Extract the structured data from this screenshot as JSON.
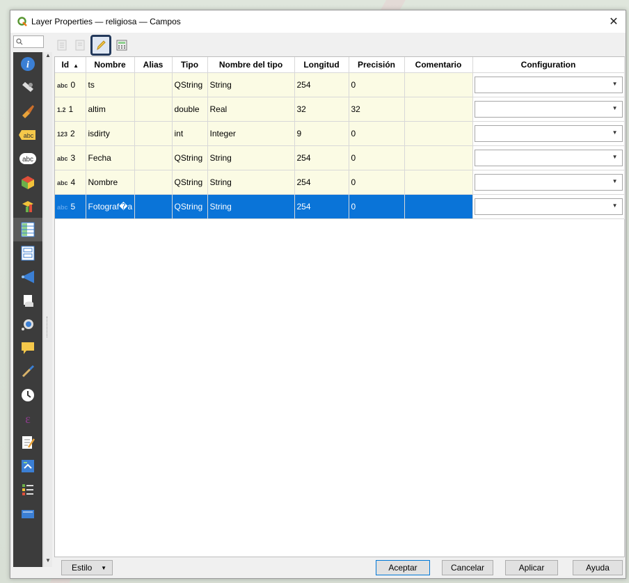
{
  "window": {
    "title": "Layer Properties — religiosa — Campos",
    "close_glyph": "✕"
  },
  "sidebar": {
    "search_glyph": "🔍",
    "items": [
      {
        "name": "information-icon"
      },
      {
        "name": "source-icon"
      },
      {
        "name": "symbology-icon"
      },
      {
        "name": "labels-icon"
      },
      {
        "name": "masks-icon"
      },
      {
        "name": "3d-view-icon"
      },
      {
        "name": "diagrams-icon"
      },
      {
        "name": "fields-icon"
      },
      {
        "name": "attributes-form-icon"
      },
      {
        "name": "joins-icon"
      },
      {
        "name": "auxiliary-storage-icon"
      },
      {
        "name": "actions-icon"
      },
      {
        "name": "display-icon"
      },
      {
        "name": "rendering-icon"
      },
      {
        "name": "temporal-icon"
      },
      {
        "name": "variables-icon"
      },
      {
        "name": "metadata-icon"
      },
      {
        "name": "dependencies-icon"
      },
      {
        "name": "legend-icon"
      },
      {
        "name": "server-icon"
      }
    ]
  },
  "toolbar": {
    "buttons": [
      "new-field-icon",
      "delete-field-icon",
      "toggle-editing-icon",
      "field-calculator-icon"
    ]
  },
  "table": {
    "headers": [
      "Id",
      "Nombre",
      "Alias",
      "Tipo",
      "Nombre del tipo",
      "Longitud",
      "Precisión",
      "Comentario",
      "Configuration"
    ],
    "rows": [
      {
        "typeicon": "abc",
        "id": "0",
        "name": "ts",
        "alias": "",
        "type": "QString",
        "typename": "String",
        "length": "254",
        "precision": "0",
        "comment": ""
      },
      {
        "typeicon": "1.2",
        "id": "1",
        "name": "altim",
        "alias": "",
        "type": "double",
        "typename": "Real",
        "length": "32",
        "precision": "32",
        "comment": ""
      },
      {
        "typeicon": "123",
        "id": "2",
        "name": "isdirty",
        "alias": "",
        "type": "int",
        "typename": "Integer",
        "length": "9",
        "precision": "0",
        "comment": ""
      },
      {
        "typeicon": "abc",
        "id": "3",
        "name": "Fecha",
        "alias": "",
        "type": "QString",
        "typename": "String",
        "length": "254",
        "precision": "0",
        "comment": ""
      },
      {
        "typeicon": "abc",
        "id": "4",
        "name": "Nombre",
        "alias": "",
        "type": "QString",
        "typename": "String",
        "length": "254",
        "precision": "0",
        "comment": ""
      },
      {
        "typeicon": "abc",
        "id": "5",
        "name": "Fotograf�a",
        "alias": "",
        "type": "QString",
        "typename": "String",
        "length": "254",
        "precision": "0",
        "comment": ""
      }
    ],
    "selected_row": 5
  },
  "footer": {
    "style_label": "Estilo",
    "accept_label": "Aceptar",
    "cancel_label": "Cancelar",
    "apply_label": "Aplicar",
    "help_label": "Ayuda"
  },
  "colors": {
    "selection": "#0a74d8",
    "row_bg": "#fbfbe4",
    "sidebar_bg": "#3c3c3c"
  }
}
